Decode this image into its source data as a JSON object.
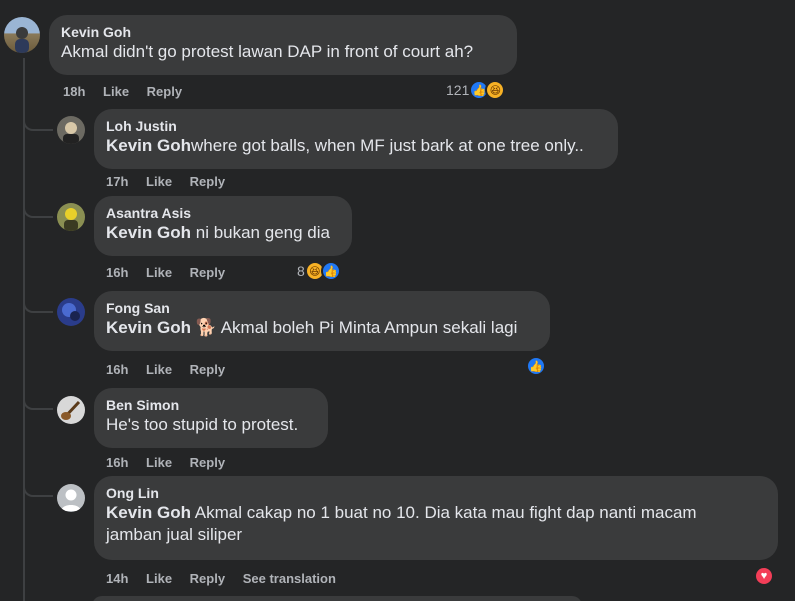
{
  "actions": {
    "like": "Like",
    "reply": "Reply",
    "see_translation": "See translation"
  },
  "comments": [
    {
      "author": "Kevin Goh",
      "mention": "",
      "text": "Akmal didn't go protest lawan DAP in front of court ah?",
      "time": "18h",
      "reaction_count": "121",
      "reactions": [
        "like-icon",
        "haha-icon"
      ]
    },
    {
      "author": "Loh Justin",
      "mention": "Kevin Goh",
      "text": "where got balls, when MF just bark at one tree only..",
      "time": "17h",
      "reaction_count": "",
      "reactions": []
    },
    {
      "author": "Asantra Asis",
      "mention": "Kevin Goh",
      "text": " ni bukan geng dia",
      "time": "16h",
      "reaction_count": "8",
      "reactions": [
        "haha-icon",
        "like-icon"
      ]
    },
    {
      "author": "Fong San",
      "mention": "Kevin Goh",
      "text": " 🐕 Akmal boleh Pi Minta Ampun sekali lagi",
      "time": "16h",
      "reaction_count": "",
      "reactions": [
        "like-icon"
      ]
    },
    {
      "author": "Ben Simon",
      "mention": "",
      "text": "He's too stupid to protest.",
      "time": "16h",
      "reaction_count": "",
      "reactions": []
    },
    {
      "author": "Ong Lin",
      "mention": "Kevin Goh",
      "text": " Akmal cakap no 1 buat no 10. Dia kata mau fight dap nanti macam jamban jual siliper",
      "time": "14h",
      "reaction_count": "",
      "reactions": [
        "love-icon"
      ]
    }
  ],
  "colors": {
    "background": "#242526",
    "bubble": "#3a3b3c",
    "like": "#2078f4",
    "haha": "#f7b125",
    "love": "#f33e58"
  }
}
